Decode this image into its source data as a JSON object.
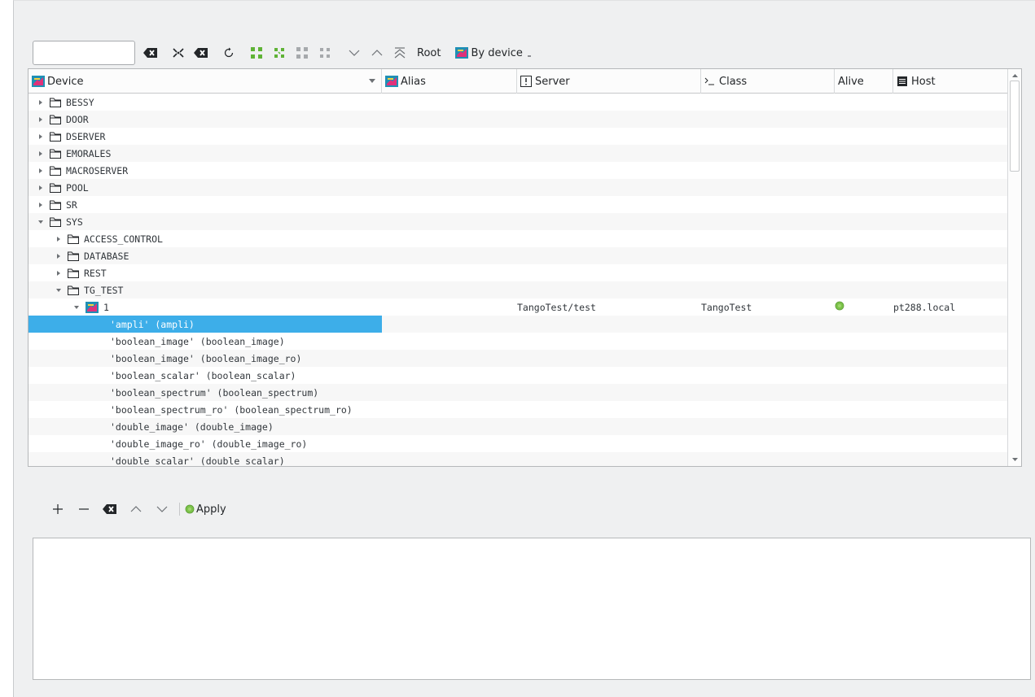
{
  "toolbar": {
    "filter_placeholder": "",
    "root_label": "Root",
    "by_device_label": "By device"
  },
  "columns": {
    "device": "Device",
    "alias": "Alias",
    "server": "Server",
    "class": "Class",
    "alive": "Alive",
    "host": "Host"
  },
  "tree": {
    "rows": [
      {
        "label": "BESSY"
      },
      {
        "label": "DOOR"
      },
      {
        "label": "DSERVER"
      },
      {
        "label": "EMORALES"
      },
      {
        "label": "MACROSERVER"
      },
      {
        "label": "POOL"
      },
      {
        "label": "SR"
      },
      {
        "label": "SYS"
      },
      {
        "label": "ACCESS_CONTROL"
      },
      {
        "label": "DATABASE"
      },
      {
        "label": "REST"
      },
      {
        "label": "TG_TEST"
      },
      {
        "label": "1",
        "server": "TangoTest/test",
        "class": "TangoTest",
        "host": "pt288.local"
      },
      {
        "label": "'ampli' (ampli)"
      },
      {
        "label": "'boolean_image' (boolean_image)"
      },
      {
        "label": "'boolean_image' (boolean_image_ro)"
      },
      {
        "label": "'boolean_scalar' (boolean_scalar)"
      },
      {
        "label": "'boolean_spectrum' (boolean_spectrum)"
      },
      {
        "label": "'boolean_spectrum_ro' (boolean_spectrum_ro)"
      },
      {
        "label": "'double_image' (double_image)"
      },
      {
        "label": "'double_image_ro' (double_image_ro)"
      },
      {
        "label": "'double_scalar' (double_scalar)"
      }
    ]
  },
  "bottom": {
    "apply_label": "Apply"
  },
  "colors": {
    "selection": "#3daee9",
    "alive_ok": "#7cc34a",
    "window_bg": "#eff0f1"
  }
}
